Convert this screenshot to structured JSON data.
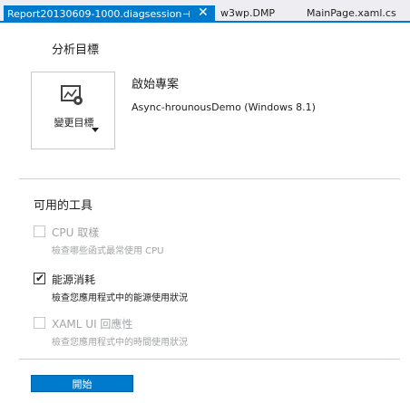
{
  "tabs": [
    {
      "label": "Report20130609-1000.diagsession",
      "active": true
    },
    {
      "label": "w3wp.DMP",
      "active": false
    },
    {
      "label": "MainPage.xaml.cs",
      "active": false
    }
  ],
  "tab_icons": {
    "pin": "pin-icon",
    "close": "close-icon"
  },
  "analysis_target": {
    "heading": "分析目標",
    "button_label": "變更目標",
    "icon": "chart-gear-icon"
  },
  "startup_project": {
    "title": "啟始專案",
    "name": "Async-hrounousDemo (Windows 8.1)"
  },
  "tools": {
    "heading": "可用的工具",
    "items": [
      {
        "title": "CPU 取樣",
        "description": "檢查哪些函式最常使用 CPU",
        "checked": false,
        "enabled": false
      },
      {
        "title": "能源消耗",
        "description": "檢查您應用程式中的能源使用狀況",
        "checked": true,
        "enabled": true
      },
      {
        "title": "XAML UI 回應性",
        "description": "檢查您應用程式中的時間使用狀況",
        "checked": false,
        "enabled": false
      }
    ]
  },
  "start_button": {
    "label": "開始"
  },
  "colors": {
    "accent": "#007acc",
    "disabled_text": "#a2a4a5",
    "tab_strip": "#eeeef2"
  }
}
